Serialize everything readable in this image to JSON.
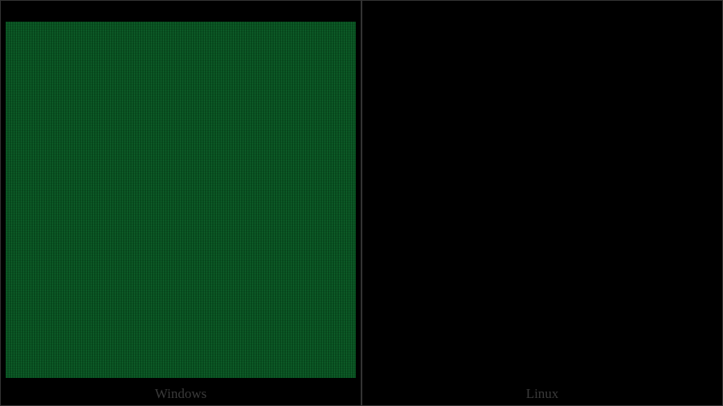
{
  "panels": {
    "left": {
      "label": "Windows",
      "fill_color": "#2e8b57"
    },
    "right": {
      "label": "Linux"
    }
  }
}
